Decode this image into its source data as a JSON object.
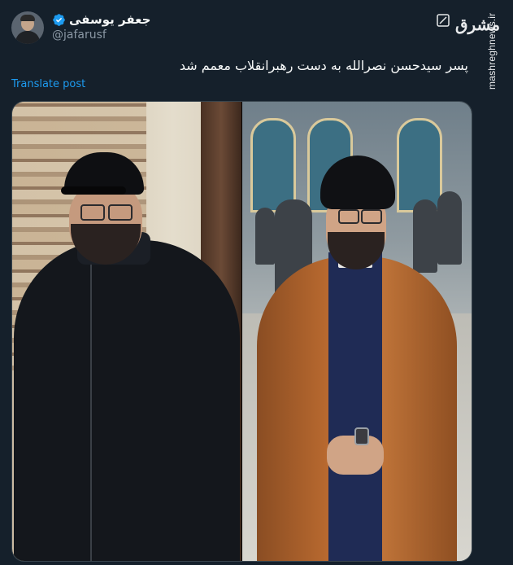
{
  "author": {
    "display_name": "جعفر یوسفی",
    "handle": "@jafarusf",
    "verified_icon": "verified-badge-icon",
    "avatar_icon": "avatar-image"
  },
  "watermark": {
    "logo_text": "مشرق",
    "url": "mashreghnews.ir"
  },
  "tweet": {
    "text": "پسر سیدحسن نصرالله به دست رهبرانقلاب معمم شد",
    "translate_label": "Translate post"
  },
  "media": {
    "left_photo": "man-in-black-cap-photo",
    "right_photo": "man-in-clerical-robe-photo"
  },
  "colors": {
    "background": "#15202b",
    "link": "#1d9bf0",
    "verified": "#1d9bf0",
    "secondary_text": "#8b98a5"
  }
}
